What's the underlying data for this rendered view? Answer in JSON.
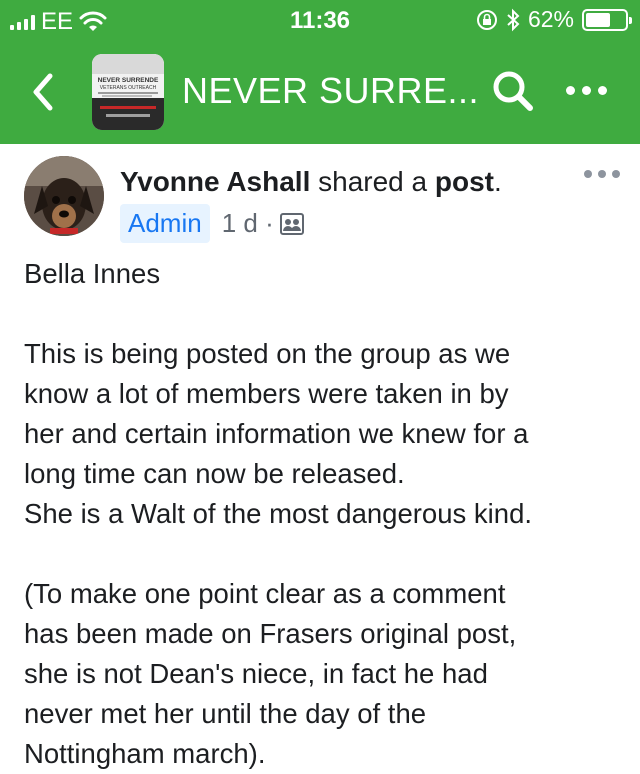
{
  "status_bar": {
    "carrier": "EE",
    "time": "11:36",
    "battery_percent": "62%",
    "battery_level": 0.62,
    "icons": [
      "signal-icon",
      "wifi-icon",
      "orientation-lock-icon",
      "bluetooth-icon",
      "battery-icon"
    ]
  },
  "nav": {
    "title": "NEVER SURRE...",
    "thumbnail_text": [
      "NEVER SURRENDE",
      "VETERANS OUTREACH"
    ],
    "icons": [
      "back-chevron-icon",
      "search-icon",
      "more-dots-icon"
    ]
  },
  "post": {
    "author": "Yvonne Ashall",
    "verb": " shared a ",
    "object": "post",
    "object_suffix": ".",
    "badge": "Admin",
    "time": "1 d",
    "separator": "·",
    "privacy_icon": "group-privacy-icon",
    "paragraphs": {
      "p1": "Bella Innes",
      "p2_l1": "This is being posted on the group as we",
      "p2_l2": "know a lot of members were taken in by",
      "p2_l3": "her and certain information we knew for a",
      "p2_l4": "long time can now be released.",
      "p2_l5": "She is a Walt of the most dangerous kind.",
      "p3_l1": "(To make one point clear as a comment",
      "p3_l2": "has been made on Frasers original post,",
      "p3_l3": "she is not Dean's niece, in fact he had",
      "p3_l4": "never met her until the day of the",
      "p3_l5": "Nottingham march)."
    }
  },
  "colors": {
    "brand_green": "#3fab40",
    "badge_blue": "#1877f2",
    "badge_bg": "#e7f3ff",
    "meta_gray": "#606770"
  }
}
